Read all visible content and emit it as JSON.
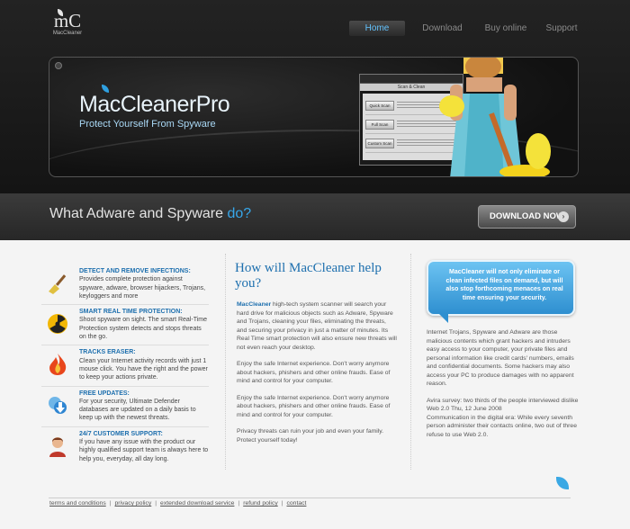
{
  "logo": {
    "mark": "mC",
    "name": "MacCleaner"
  },
  "nav": {
    "items": [
      "Home",
      "Download",
      "Buy online",
      "Support"
    ],
    "active": "Home"
  },
  "banner": {
    "product_name": "MacCleanerPro",
    "tagline": "Protect Yourself From Spyware",
    "app": {
      "title": "Scan & Clean",
      "buttons": [
        "Quick Scan",
        "Full Scan",
        "Custom Scan"
      ]
    }
  },
  "strip": {
    "question_main": "What Adware and Spyware ",
    "question_accent": "do?",
    "download_label": "DOWNLOAD NOW",
    "download_arrow": "›"
  },
  "features": [
    {
      "icon": "broom-icon",
      "title": "DETECT AND REMOVE INFECTIONS:",
      "text": "Provides complete protection against spyware, adware, browser hijackers, Trojans, keyloggers and more"
    },
    {
      "icon": "radiation-icon",
      "title": "SMART REAL TIME PROTECTION:",
      "text": "Shoot spyware on sight. The smart Real-Time Protection system detects and stops threats on the go."
    },
    {
      "icon": "fire-icon",
      "title": "TRACKS ERASER:",
      "text": "Clean your Internet activity records with just 1 mouse click. You have the right and the power to keep your actions private."
    },
    {
      "icon": "download-icon",
      "title": "FREE UPDATES:",
      "text": "For your security, Ultimate Defender databases are updated on a daily basis to keep up with the newest threats."
    },
    {
      "icon": "support-person-icon",
      "title": "24/7 CUSTOMER SUPPORT:",
      "text": "If you have any issue with the product our highly qualified support team is always here to help you, everyday, all day long."
    }
  ],
  "middle": {
    "heading": "How will MacCleaner help you?",
    "intro_brand": "MacCleaner",
    "intro_text": " high-tech system scanner will search your hard drive for malicious objects such as Adware, Spyware and Trojans, cleaning your files, eliminating the threats, and securing your privacy in just a matter of minutes. Its Real Time smart protection will also ensure new threats will not even reach your desktop.",
    "paragraphs": [
      "Enjoy the safe Internet experience. Don't worry anymore about hackers, phishers and other online frauds. Ease of mind and control for your computer.",
      "Enjoy the safe Internet experience. Don't worry anymore about hackers, phishers and other online frauds. Ease of mind and control for your computer.",
      "Privacy threats can ruin your job and even your family. Protect yourself today!"
    ]
  },
  "right": {
    "bubble": "MacCleaner will not only eliminate or clean infected files on demand, but will also stop forthcoming menaces on real time ensuring your security.",
    "p1": "Internet Trojans, Spyware and Adware are those malicious contents which grant hackers and intruders easy access to your computer, your private files and personal information like credit cards' numbers, emails and confidential documents. Some hackers may also access your PC to produce damages with no apparent reason.",
    "p2_line1": "Avira survey: two thirds of the people interviewed dislike Web 2.0  Thu, 12 June 2008",
    "p2_line2": "Communication in the digital era: While every seventh person administer their contacts online, two out of three refuse to use Web 2.0."
  },
  "footer": {
    "links": [
      "terms and conditions",
      "privacy policy",
      "extended download service",
      "refund policy",
      "contact"
    ]
  },
  "colors": {
    "accent": "#1d6fae",
    "bubble": "#2e8fd0",
    "nav_active": "#64c4ff"
  }
}
